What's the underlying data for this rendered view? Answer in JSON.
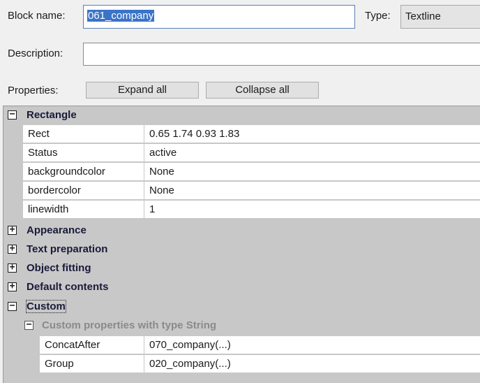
{
  "header": {
    "block_name_label": "Block name:",
    "block_name_value": "061_company",
    "type_label": "Type:",
    "type_value": "Textline",
    "description_label": "Description:",
    "description_value": "",
    "properties_label": "Properties:",
    "expand_all": "Expand all",
    "collapse_all": "Collapse all"
  },
  "grid": {
    "rectangle": {
      "label": "Rectangle",
      "toggle": "−",
      "props": [
        {
          "name": "Rect",
          "value": "0.65 1.74 0.93 1.83"
        },
        {
          "name": "Status",
          "value": "active"
        },
        {
          "name": "backgroundcolor",
          "value": "None"
        },
        {
          "name": "bordercolor",
          "value": "None"
        },
        {
          "name": "linewidth",
          "value": "1"
        }
      ]
    },
    "appearance": {
      "label": "Appearance",
      "toggle": "+"
    },
    "text_preparation": {
      "label": "Text preparation",
      "toggle": "+"
    },
    "object_fitting": {
      "label": "Object fitting",
      "toggle": "+"
    },
    "default_contents": {
      "label": "Default contents",
      "toggle": "+"
    },
    "custom": {
      "label": "Custom",
      "toggle": "−",
      "subgroup": {
        "label": "Custom properties with type String",
        "toggle": "−",
        "props": [
          {
            "name": "ConcatAfter",
            "value": "070_company(...)"
          },
          {
            "name": "Group",
            "value": "020_company(...)"
          }
        ]
      }
    }
  },
  "colors": {
    "selection": "#3a74c8",
    "grid_category_bg": "#c8c8c8",
    "window_bg": "#f0f0f0"
  }
}
